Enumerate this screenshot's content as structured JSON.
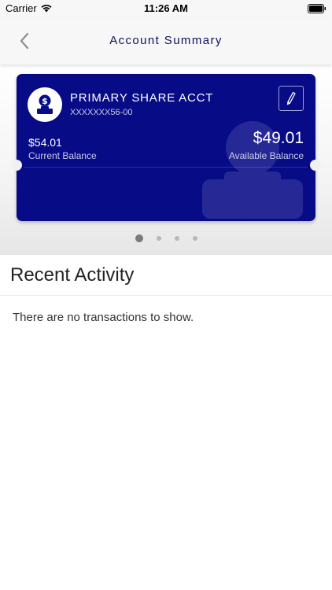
{
  "status_bar": {
    "carrier": "Carrier",
    "time": "11:26 AM"
  },
  "header": {
    "title": "Account Summary",
    "back_icon": "chevron-left-icon"
  },
  "account_card": {
    "name": "PRIMARY SHARE ACCT",
    "number": "XXXXXXX56-00",
    "current_balance": "$54.01",
    "current_balance_label": "Current Balance",
    "available_balance": "$49.01",
    "available_balance_label": "Available Balance",
    "avatar_icon": "money-hand-icon",
    "edit_icon": "pencil-icon",
    "card_color": "#070b86"
  },
  "pager": {
    "count": 4,
    "active_index": 0
  },
  "recent_activity": {
    "title": "Recent Activity",
    "empty_message": "There are no transactions to show."
  },
  "colors": {
    "accent": "#0f1060",
    "card_background": "#070b86"
  }
}
